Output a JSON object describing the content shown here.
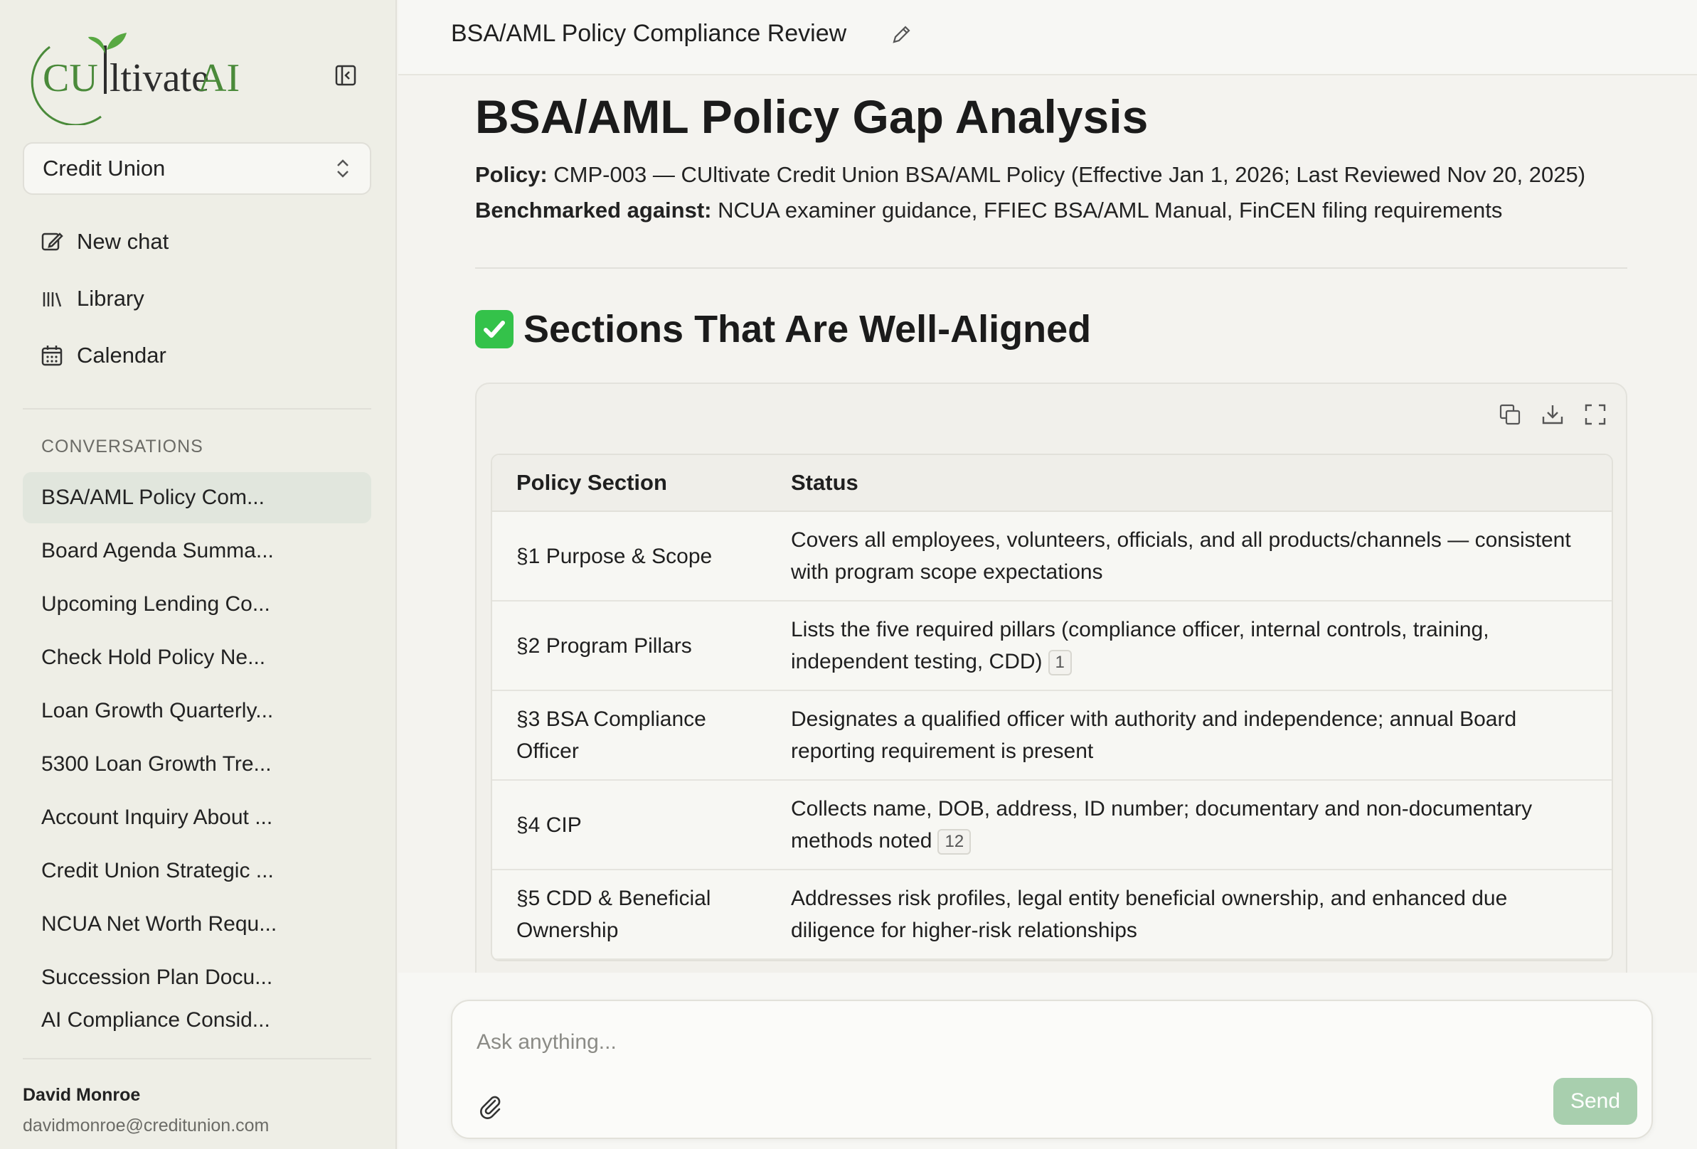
{
  "brand": {
    "logo_prefix": "CU",
    "logo_middle": "ltivate",
    "logo_suffix": "AI",
    "accent_green": "#4a8a3a",
    "send_button_color": "#a8cfae"
  },
  "sidebar": {
    "org_selector": {
      "value": "Credit Union"
    },
    "nav": [
      {
        "label": "New chat",
        "icon": "edit-icon"
      },
      {
        "label": "Library",
        "icon": "library-icon"
      },
      {
        "label": "Calendar",
        "icon": "calendar-icon"
      }
    ],
    "conversations_heading": "CONVERSATIONS",
    "conversations": [
      "BSA/AML Policy Com...",
      "Board Agenda Summa...",
      "Upcoming Lending Co...",
      "Check Hold Policy Ne...",
      "Loan Growth Quarterly...",
      "5300 Loan Growth Tre...",
      "Account Inquiry About ...",
      "Credit Union Strategic ...",
      "NCUA Net Worth Requ...",
      "Succession Plan Docu...",
      "AI Compliance Consid..."
    ],
    "user": {
      "name": "David Monroe",
      "email": "davidmonroe@creditunion.com"
    }
  },
  "header": {
    "title": "BSA/AML Policy Compliance Review"
  },
  "document": {
    "title": "BSA/AML Policy Gap Analysis",
    "policy_label": "Policy:",
    "policy_value": "CMP-003 — CUltivate Credit Union BSA/AML Policy (Effective Jan 1, 2026; Last Reviewed Nov 20, 2025)",
    "benchmark_label": "Benchmarked against:",
    "benchmark_value": "NCUA examiner guidance, FFIEC BSA/AML Manual, FinCEN filing requirements",
    "section_heading": "Sections That Are Well-Aligned",
    "table": {
      "headers": [
        "Policy Section",
        "Status"
      ],
      "rows": [
        {
          "section": "§1 Purpose & Scope",
          "status": "Covers all employees, volunteers, officials, and all products/channels — consistent with program scope expectations",
          "cite": ""
        },
        {
          "section": "§2 Program Pillars",
          "status": "Lists the five required pillars (compliance officer, internal controls, training, independent testing, CDD)",
          "cite": "1"
        },
        {
          "section": "§3 BSA Compliance Officer",
          "status": "Designates a qualified officer with authority and independence; annual Board reporting requirement is present",
          "cite": ""
        },
        {
          "section": "§4 CIP",
          "status": "Collects name, DOB, address, ID number; documentary and non-documentary methods noted",
          "cite": "12"
        },
        {
          "section": "§5 CDD & Beneficial Ownership",
          "status": "Addresses risk profiles, legal entity beneficial ownership, and enhanced due diligence for higher-risk relationships",
          "cite": ""
        }
      ]
    }
  },
  "composer": {
    "placeholder": "Ask anything...",
    "send_label": "Send"
  }
}
